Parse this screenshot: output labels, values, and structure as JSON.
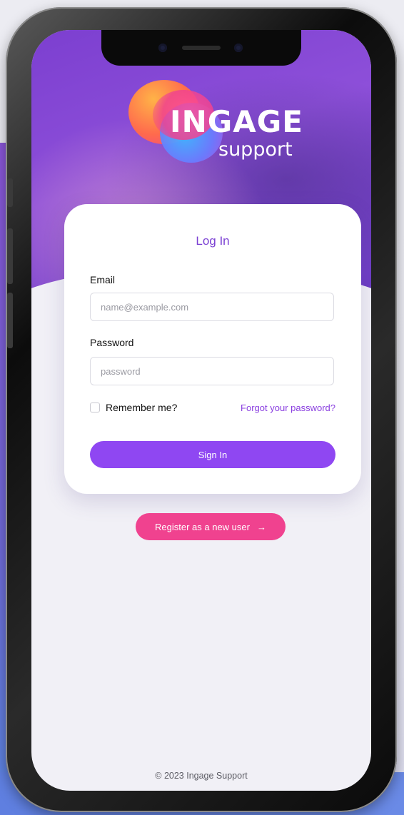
{
  "brand": {
    "logo_main": "INGAGE",
    "logo_sub": "support"
  },
  "login_card": {
    "title": "Log In",
    "email_label": "Email",
    "email_placeholder": "name@example.com",
    "email_value": "",
    "password_label": "Password",
    "password_placeholder": "password",
    "password_value": "",
    "remember_label": "Remember me?",
    "remember_checked": false,
    "forgot_link": "Forgot your password?",
    "signin_label": "Sign In"
  },
  "register": {
    "label": "Register as a new user",
    "arrow": "→"
  },
  "footer": {
    "copyright": "© 2023 Ingage Support"
  },
  "colors": {
    "accent_purple": "#8f47f2",
    "link_purple": "#8a3fe0",
    "register_pink": "#f0428f",
    "hero_purple": "#7c3fd0"
  }
}
